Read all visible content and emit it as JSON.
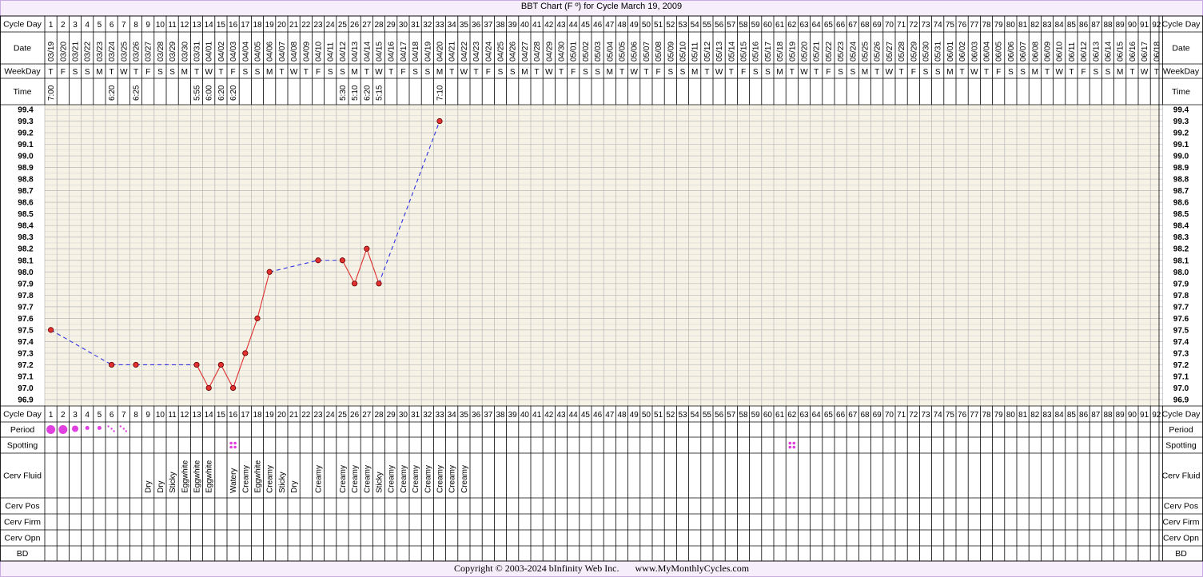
{
  "title": "BBT Chart (F º) for Cycle March 19, 2009",
  "footer": {
    "copyright": "Copyright © 2003-2024 bInfinity Web Inc.",
    "site": "www.MyMonthlyCycles.com"
  },
  "row_labels": {
    "cycle_day": "Cycle Day",
    "date": "Date",
    "weekday": "WeekDay",
    "time": "Time",
    "period": "Period",
    "spotting": "Spotting",
    "cerv_fluid": "Cerv Fluid",
    "cerv_pos": "Cerv Pos",
    "cerv_firm": "Cerv Firm",
    "cerv_opn": "Cerv Opn",
    "bd": "BD"
  },
  "colors": {
    "grid_bg": "#f6f3e6",
    "line_solid": "#e03030",
    "line_dashed": "#3030e0",
    "dot": "#e03030",
    "period": "#e040e0",
    "border": "#c9a9e6"
  },
  "chart_data": {
    "type": "line",
    "title": "BBT Chart (F º) for Cycle March 19, 2009",
    "xlabel": "Cycle Day",
    "ylabel": "",
    "ylim": [
      96.9,
      99.4
    ],
    "y_ticks": [
      "99.4",
      "99.3",
      "99.2",
      "99.1",
      "99.0",
      "98.9",
      "98.8",
      "98.7",
      "98.6",
      "98.5",
      "98.4",
      "98.3",
      "98.2",
      "98.1",
      "98.0",
      "97.9",
      "97.8",
      "97.7",
      "97.6",
      "97.5",
      "97.4",
      "97.3",
      "97.2",
      "97.1",
      "97.0",
      "96.9"
    ],
    "cycle_days": 92,
    "dates": [
      "03/19",
      "03/20",
      "03/21",
      "03/22",
      "03/23",
      "03/24",
      "03/25",
      "03/26",
      "03/27",
      "03/28",
      "03/29",
      "03/30",
      "03/31",
      "04/01",
      "04/02",
      "04/03",
      "04/04",
      "04/05",
      "04/06",
      "04/07",
      "04/08",
      "04/09",
      "04/10",
      "04/11",
      "04/12",
      "04/13",
      "04/14",
      "04/15",
      "04/16",
      "04/17",
      "04/18",
      "04/19",
      "04/20",
      "04/21",
      "04/22",
      "04/23",
      "04/24",
      "04/25",
      "04/26",
      "04/27",
      "04/28",
      "04/29",
      "04/30",
      "05/01",
      "05/02",
      "05/03",
      "05/04",
      "05/05",
      "05/06",
      "05/07",
      "05/08",
      "05/09",
      "05/10",
      "05/11",
      "05/12",
      "05/13",
      "05/14",
      "05/15",
      "05/16",
      "05/17",
      "05/18",
      "05/19",
      "05/20",
      "05/21",
      "05/22",
      "05/23",
      "05/24",
      "05/25",
      "05/26",
      "05/27",
      "05/28",
      "05/29",
      "05/30",
      "05/31",
      "06/01",
      "06/02",
      "06/03",
      "06/04",
      "06/05",
      "06/06",
      "06/07",
      "06/08",
      "06/09",
      "06/10",
      "06/11",
      "06/12",
      "06/13",
      "06/14",
      "06/15",
      "06/16",
      "06/17",
      "06/18"
    ],
    "weekdays": [
      "T",
      "F",
      "S",
      "S",
      "M",
      "T",
      "W",
      "T",
      "F",
      "S",
      "S",
      "M",
      "T",
      "W",
      "T",
      "F",
      "S",
      "S",
      "M",
      "T",
      "W",
      "T",
      "F",
      "S",
      "S",
      "M",
      "T",
      "W",
      "T",
      "F",
      "S",
      "S",
      "M",
      "T",
      "W",
      "T",
      "F",
      "S",
      "S",
      "M",
      "T",
      "W",
      "T",
      "F",
      "S",
      "S",
      "M",
      "T",
      "W",
      "T",
      "F",
      "S",
      "S",
      "M",
      "T",
      "W",
      "T",
      "F",
      "S",
      "S",
      "M",
      "T",
      "W",
      "T",
      "F",
      "S",
      "S",
      "M",
      "T",
      "W",
      "T",
      "F",
      "S",
      "S",
      "M",
      "T",
      "W",
      "T",
      "F",
      "S",
      "S",
      "M",
      "T",
      "W",
      "T",
      "F",
      "S",
      "S",
      "M",
      "T",
      "W",
      "T"
    ],
    "times": [
      {
        "day": 1,
        "value": "7:00"
      },
      {
        "day": 6,
        "value": "6:20"
      },
      {
        "day": 8,
        "value": "6:25"
      },
      {
        "day": 13,
        "value": "5:55"
      },
      {
        "day": 14,
        "value": "6:00"
      },
      {
        "day": 15,
        "value": "6:20"
      },
      {
        "day": 16,
        "value": "6:20"
      },
      {
        "day": 25,
        "value": "5:30"
      },
      {
        "day": 26,
        "value": "5:10"
      },
      {
        "day": 27,
        "value": "6:20"
      },
      {
        "day": 28,
        "value": "5:15"
      },
      {
        "day": 33,
        "value": "7:10"
      }
    ],
    "temperatures": [
      {
        "day": 1,
        "temp": 97.5
      },
      {
        "day": 6,
        "temp": 97.2
      },
      {
        "day": 8,
        "temp": 97.2
      },
      {
        "day": 13,
        "temp": 97.2
      },
      {
        "day": 14,
        "temp": 97.0
      },
      {
        "day": 15,
        "temp": 97.2
      },
      {
        "day": 16,
        "temp": 97.0
      },
      {
        "day": 17,
        "temp": 97.3
      },
      {
        "day": 18,
        "temp": 97.6
      },
      {
        "day": 19,
        "temp": 98.0
      },
      {
        "day": 23,
        "temp": 98.1
      },
      {
        "day": 25,
        "temp": 98.1
      },
      {
        "day": 26,
        "temp": 97.9
      },
      {
        "day": 27,
        "temp": 98.2
      },
      {
        "day": 28,
        "temp": 97.9
      },
      {
        "day": 33,
        "temp": 99.3
      }
    ],
    "period": [
      {
        "day": 1,
        "level": "heavy"
      },
      {
        "day": 2,
        "level": "heavy"
      },
      {
        "day": 3,
        "level": "medium"
      },
      {
        "day": 4,
        "level": "light"
      },
      {
        "day": 5,
        "level": "light"
      },
      {
        "day": 6,
        "level": "spot"
      },
      {
        "day": 7,
        "level": "spot"
      }
    ],
    "spotting": [
      16,
      62
    ],
    "cerv_fluid": [
      {
        "day": 9,
        "value": "Dry"
      },
      {
        "day": 10,
        "value": "Dry"
      },
      {
        "day": 11,
        "value": "Sticky"
      },
      {
        "day": 12,
        "value": "Eggwhite"
      },
      {
        "day": 13,
        "value": "Eggwhite"
      },
      {
        "day": 14,
        "value": "Eggwhite"
      },
      {
        "day": 16,
        "value": "Watery"
      },
      {
        "day": 17,
        "value": "Creamy"
      },
      {
        "day": 18,
        "value": "Eggwhite"
      },
      {
        "day": 19,
        "value": "Creamy"
      },
      {
        "day": 20,
        "value": "Sticky"
      },
      {
        "day": 21,
        "value": "Dry"
      },
      {
        "day": 23,
        "value": "Creamy"
      },
      {
        "day": 25,
        "value": "Creamy"
      },
      {
        "day": 26,
        "value": "Creamy"
      },
      {
        "day": 27,
        "value": "Creamy"
      },
      {
        "day": 28,
        "value": "Sticky"
      },
      {
        "day": 29,
        "value": "Creamy"
      },
      {
        "day": 30,
        "value": "Creamy"
      },
      {
        "day": 31,
        "value": "Creamy"
      },
      {
        "day": 32,
        "value": "Creamy"
      },
      {
        "day": 33,
        "value": "Creamy"
      },
      {
        "day": 34,
        "value": "Creamy"
      },
      {
        "day": 35,
        "value": "Creamy"
      }
    ]
  }
}
